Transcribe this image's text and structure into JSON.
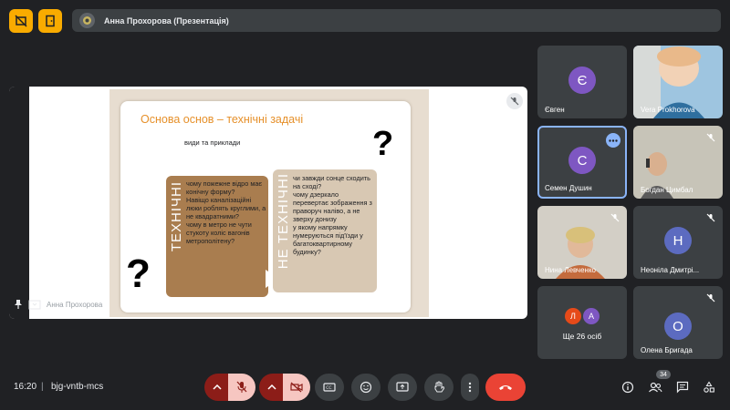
{
  "header": {
    "presenter_title": "Анна Прохорова (Презентація)"
  },
  "slide": {
    "title": "Основа основ – технічні задачі",
    "subtitle": "види та приклади",
    "card1_label": "ТЕХНІЧНІ",
    "card1_text": "чому пожежне відро має конічну форму?\nНавіщо каналізаційні люки роблять круглими, а не квадратними?\nчому в метро не чути стукоту коліс вагонів метрополітену?",
    "card2_label": "НЕ ТЕХНІЧНІ",
    "card2_text": "чи завжди сонце сходить на сході?\nчому дзеркало перевертає зображення з праворуч наліво, а не зверху донизу\nу якому напрямку нумеруються під'їзди у багатоквартирному будинку?",
    "qmark": "?"
  },
  "presenter_label": "Анна Прохорова",
  "participants": [
    {
      "name": "Євген",
      "initial": "Є",
      "color": "#7e57c2"
    },
    {
      "name": "Vera Prokhorova",
      "photo": true
    },
    {
      "name": "Семен Душин",
      "initial": "С",
      "color": "#7e57c2",
      "active": true
    },
    {
      "name": "Богдан Цимбал",
      "photo": true
    },
    {
      "name": "Нина Левченко",
      "photo": true
    },
    {
      "name": "Неоніла Дмитрі...",
      "initial": "Н",
      "color": "#5c6bc0"
    },
    {
      "name": "Ще 26 осіб",
      "initials": [
        "Л",
        "А"
      ],
      "colors": [
        "#e64a19",
        "#7e57c2"
      ]
    },
    {
      "name": "Олена Бригада",
      "initial": "О",
      "color": "#5c6bc0"
    }
  ],
  "meeting": {
    "time": "16:20",
    "separator": "|",
    "code": "bjg-vntb-mcs",
    "people_count": "34"
  },
  "colors": {
    "accent_orange": "#e6902a",
    "end_call_red": "#ea4335",
    "top_icon_yellow": "#f9ab00"
  }
}
